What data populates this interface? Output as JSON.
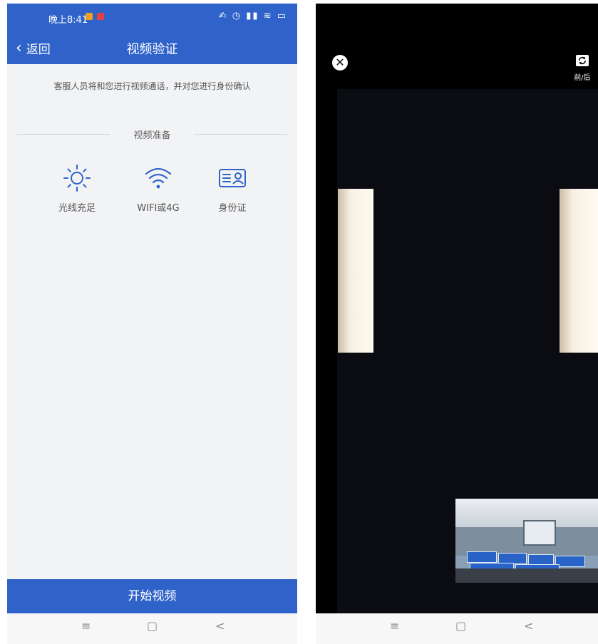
{
  "left": {
    "status_time": "晚上8:41",
    "status_icons": "✍ ◷ ▮▮ ≋ ▭",
    "back_label": "返回",
    "title": "视频验证",
    "intro": "客服人员将和您进行视频通话，并对您进行身份确认",
    "section_title": "视频准备",
    "items": [
      {
        "label": "光线充足",
        "icon": "sun-icon"
      },
      {
        "label": "WIFI或4G",
        "icon": "wifi-icon"
      },
      {
        "label": "身份证",
        "icon": "id-card-icon"
      }
    ],
    "start_button": "开始视频",
    "nav": {
      "menu": "≡",
      "home": "▢",
      "back": "<"
    }
  },
  "right": {
    "flip_label": "前/后",
    "nav": {
      "menu": "≡",
      "home": "▢",
      "back": "<"
    }
  },
  "colors": {
    "brand": "#2f63c9",
    "page_bg": "#f2f3f5"
  }
}
